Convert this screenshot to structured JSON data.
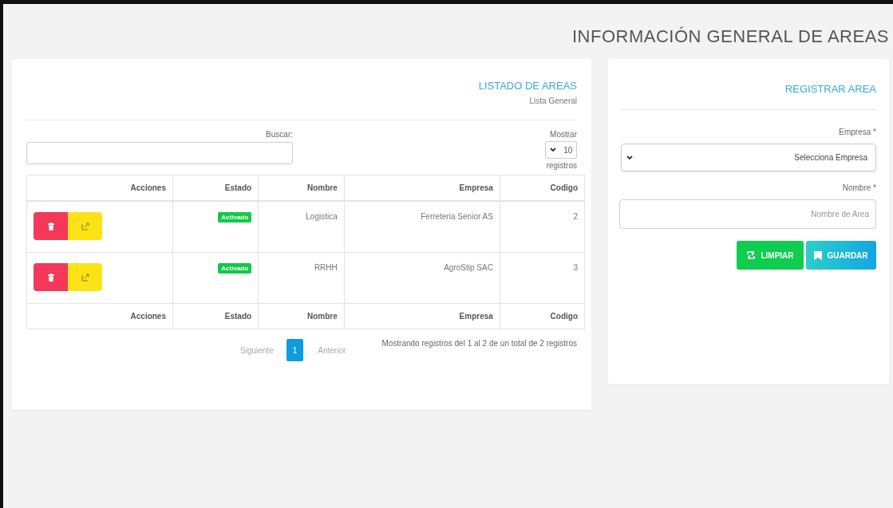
{
  "page_title": "INFORMACIÓN GENERAL DE AREAS",
  "form": {
    "title": "REGISTRAR AREA",
    "fields": [
      {
        "kind": "select",
        "label": "Empresa *",
        "value": "Selecciona Empresa"
      },
      {
        "kind": "text",
        "label": "Nombre *",
        "placeholder": "Nombre de Area"
      }
    ],
    "buttons": [
      {
        "kind": "clear",
        "label": "LIMPIAR"
      },
      {
        "kind": "save",
        "label": "GUARDAR"
      }
    ]
  },
  "list": {
    "title": "LISTADO DE AREAS",
    "subtitle": "Lista General",
    "show": {
      "label": "Mostrar",
      "value": "10",
      "suffix": "registros"
    },
    "search": {
      "label": "Buscar:"
    },
    "table": {
      "columns": [
        {
          "kind": "actions",
          "label": "Acciones"
        },
        {
          "kind": "status",
          "label": "Estado"
        },
        {
          "kind": "text",
          "label": "Nombre"
        },
        {
          "kind": "text",
          "label": "Empresa"
        },
        {
          "kind": "text",
          "label": "Codigo"
        }
      ],
      "rows": [
        {
          "cells": [
            "",
            "Activado",
            "Logistica",
            "Ferreteria Senior AS",
            "2"
          ]
        },
        {
          "cells": [
            "",
            "Activado",
            "RRHH",
            "AgroStip SAC",
            "3"
          ]
        }
      ],
      "footer": [
        "Acciones",
        "Estado",
        "Nombre",
        "Empresa",
        "Codigo"
      ]
    },
    "info": "Mostrando registros del 1 al 2 de un total de 2 registros",
    "pagination": [
      {
        "kind": "next",
        "label": "Siguiente",
        "selected": false
      },
      {
        "kind": "page",
        "label": "1",
        "selected": true
      },
      {
        "kind": "prev",
        "label": "Anterior",
        "selected": false
      }
    ]
  }
}
